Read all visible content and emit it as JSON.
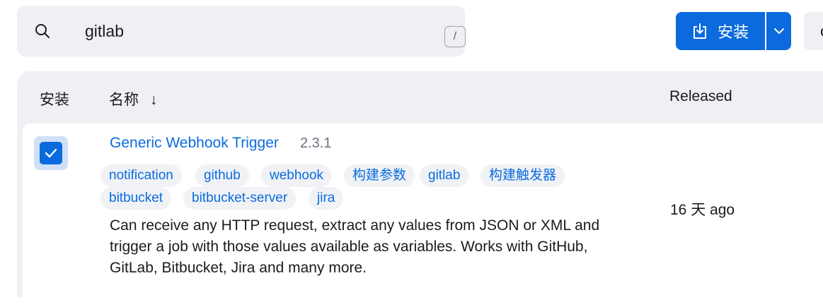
{
  "search": {
    "value": "gitlab",
    "shortcut": "/"
  },
  "toolbar": {
    "install_label": "安装"
  },
  "table": {
    "headers": {
      "install": "安装",
      "name": "名称",
      "sort_indicator": "↓",
      "released": "Released"
    },
    "rows": [
      {
        "checked": true,
        "name": "Generic Webhook Trigger",
        "version": "2.3.1",
        "tags": [
          "notification",
          "github",
          "webhook",
          "构建参数",
          "gitlab",
          "构建触发器",
          "bitbucket",
          "bitbucket-server",
          "jira"
        ],
        "description": "Can receive any HTTP request, extract any values from JSON or XML and trigger a job with those values available as variables. Works with GitHub, GitLab, Bitbucket, Jira and many more.",
        "released": "16 天 ago"
      }
    ]
  },
  "colors": {
    "accent": "#0b6bde",
    "surface": "#f0f0f4",
    "tag_bg": "#f0f2f6"
  }
}
